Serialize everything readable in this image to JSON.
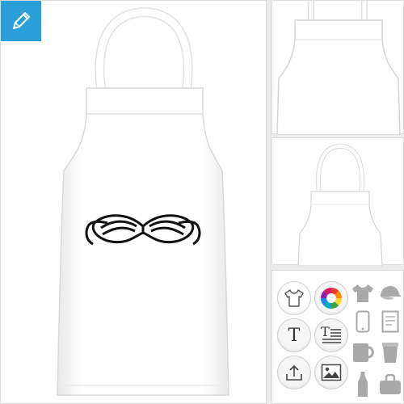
{
  "app": {
    "accent": "#2a9fd8"
  },
  "editor": {
    "edit_icon": "pencil-icon"
  },
  "main_preview": {
    "product": "apron",
    "design": "mustache-design"
  },
  "thumbnails": [
    {
      "view": "apron-front-closeup"
    },
    {
      "view": "apron-full"
    }
  ],
  "tools": {
    "row1": [
      {
        "icon": "tshirt-icon"
      },
      {
        "icon": "color-wheel-icon"
      }
    ],
    "row2": [
      {
        "icon": "text-icon",
        "label": "T"
      },
      {
        "icon": "text-block-icon",
        "label": "T"
      }
    ],
    "row3": [
      {
        "icon": "upload-icon"
      },
      {
        "icon": "image-icon"
      }
    ]
  },
  "products": [
    {
      "icon": "tshirt-product-icon"
    },
    {
      "icon": "cap-product-icon"
    },
    {
      "icon": "phone-case-product-icon"
    },
    {
      "icon": "notebook-product-icon"
    },
    {
      "icon": "mug-product-icon"
    },
    {
      "icon": "cup-product-icon"
    },
    {
      "icon": "bottle-product-icon"
    },
    {
      "icon": "bag-product-icon"
    }
  ],
  "colors": {
    "color_wheel": [
      "#e53935",
      "#fb8c00",
      "#fdd835",
      "#43a047",
      "#00acc1",
      "#1e88e5",
      "#8e24aa",
      "#d81b60"
    ],
    "product_grey": "#a9a9a9"
  }
}
